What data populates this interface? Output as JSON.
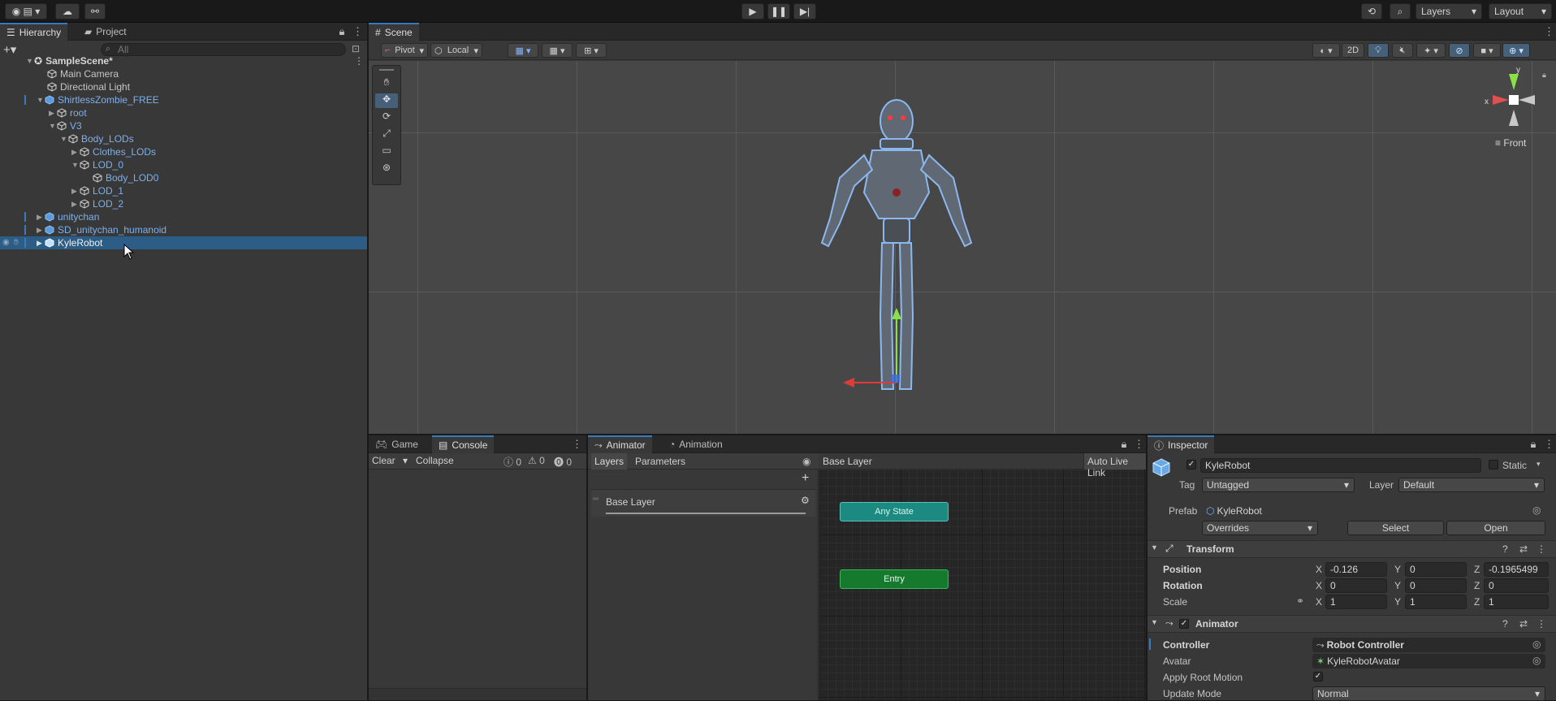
{
  "toolbar": {
    "layers_label": "Layers",
    "layout_label": "Layout"
  },
  "hierarchy": {
    "tab_hierarchy": "Hierarchy",
    "tab_project": "Project",
    "search_placeholder": "All",
    "scene_name": "SampleScene*",
    "items": [
      {
        "label": "Main Camera"
      },
      {
        "label": "Directional Light"
      },
      {
        "label": "ShirtlessZombie_FREE"
      },
      {
        "label": "root"
      },
      {
        "label": "V3"
      },
      {
        "label": "Body_LODs"
      },
      {
        "label": "Clothes_LODs"
      },
      {
        "label": "LOD_0"
      },
      {
        "label": "Body_LOD0"
      },
      {
        "label": "LOD_1"
      },
      {
        "label": "LOD_2"
      },
      {
        "label": "unitychan"
      },
      {
        "label": "SD_unitychan_humanoid"
      },
      {
        "label": "KyleRobot"
      }
    ]
  },
  "scene": {
    "tab": "Scene",
    "pivot": "Pivot",
    "local": "Local",
    "mode_2d": "2D",
    "gizmo_view": "Front",
    "axis_x": "x",
    "axis_y": "y"
  },
  "game_console": {
    "tab_game": "Game",
    "tab_console": "Console",
    "clear": "Clear",
    "collapse": "Collapse",
    "count_info": "0",
    "count_warn": "0",
    "count_error": "0"
  },
  "animator": {
    "tab_animator": "Animator",
    "tab_animation": "Animation",
    "tab_layers": "Layers",
    "tab_parameters": "Parameters",
    "breadcrumb": "Base Layer",
    "auto_live_link": "Auto Live Link",
    "layer_name": "Base Layer",
    "state_any": "Any State",
    "state_entry": "Entry"
  },
  "inspector": {
    "tab": "Inspector",
    "object_name": "KyleRobot",
    "static_label": "Static",
    "tag_label": "Tag",
    "tag_value": "Untagged",
    "layer_label": "Layer",
    "layer_value": "Default",
    "prefab_label": "Prefab",
    "prefab_value": "KyleRobot",
    "overrides": "Overrides",
    "select": "Select",
    "open": "Open",
    "transform": {
      "title": "Transform",
      "position_label": "Position",
      "rotation_label": "Rotation",
      "scale_label": "Scale",
      "position": {
        "x": "-0.126",
        "y": "0",
        "z": "-0.1965499"
      },
      "rotation": {
        "x": "0",
        "y": "0",
        "z": "0"
      },
      "scale": {
        "x": "1",
        "y": "1",
        "z": "1"
      },
      "axis_x": "X",
      "axis_y": "Y",
      "axis_z": "Z"
    },
    "animator": {
      "title": "Animator",
      "controller_label": "Controller",
      "controller_value": "Robot Controller",
      "avatar_label": "Avatar",
      "avatar_value": "KyleRobotAvatar",
      "apply_root_motion_label": "Apply Root Motion",
      "update_mode_label": "Update Mode",
      "update_mode_value": "Normal"
    }
  },
  "colors": {
    "accent_blue": "#3a79bb",
    "prefab_text": "#7cb0ee",
    "selection": "#2c5d87",
    "state_any": "#1c8a80",
    "state_entry": "#157a2e"
  }
}
